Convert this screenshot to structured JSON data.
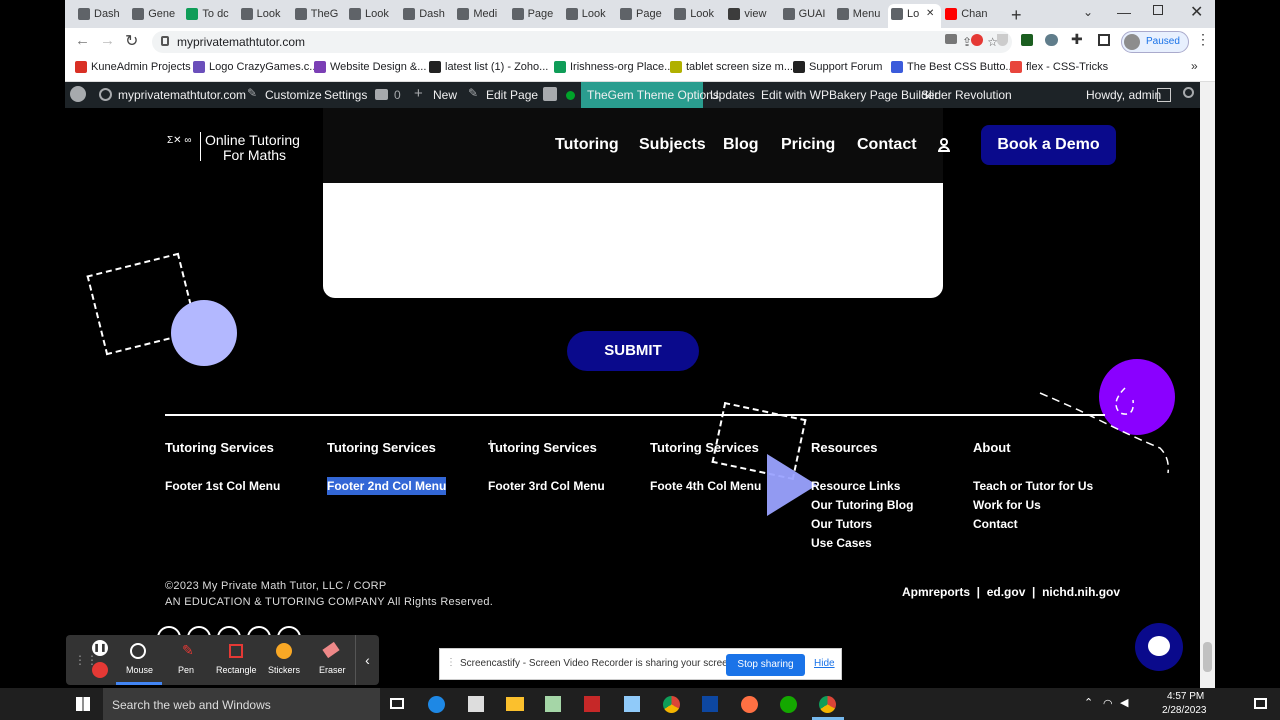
{
  "browser": {
    "tabs": [
      {
        "label": "Dash",
        "color": "#5f6368"
      },
      {
        "label": "Gene",
        "color": "#5f6368"
      },
      {
        "label": "To dc",
        "color": "#0f9d58"
      },
      {
        "label": "Look",
        "color": "#5f6368"
      },
      {
        "label": "TheG",
        "color": "#5f6368"
      },
      {
        "label": "Look",
        "color": "#5f6368"
      },
      {
        "label": "Dash",
        "color": "#5f6368"
      },
      {
        "label": "Medi",
        "color": "#5f6368"
      },
      {
        "label": "Page",
        "color": "#5f6368"
      },
      {
        "label": "Look",
        "color": "#5f6368"
      },
      {
        "label": "Page",
        "color": "#5f6368"
      },
      {
        "label": "Look",
        "color": "#5f6368"
      },
      {
        "label": "view",
        "color": "#3c3c3c"
      },
      {
        "label": "GUAI",
        "color": "#5f6368"
      },
      {
        "label": "Menu",
        "color": "#5f6368"
      },
      {
        "label": "Lo",
        "color": "#5f6368"
      },
      {
        "label": "Chan",
        "color": "#ff0000"
      }
    ],
    "url": "myprivatemathtutor.com",
    "profile_status": "Paused",
    "bookmarks": [
      {
        "label": "KuneAdmin Projects",
        "color": "#d93025"
      },
      {
        "label": "Logo CrazyGames.c...",
        "color": "#6b4fbb"
      },
      {
        "label": "Website Design &...",
        "color": "#7b3fb5"
      },
      {
        "label": "latest list (1) - Zoho...",
        "color": "#222222"
      },
      {
        "label": "Irishness-org Place...",
        "color": "#0f9d58"
      },
      {
        "label": "tablet screen size m...",
        "color": "#b0b000"
      },
      {
        "label": "Support Forum",
        "color": "#222222"
      },
      {
        "label": "The Best CSS Butto...",
        "color": "#3b5bdb"
      },
      {
        "label": "flex - CSS-Tricks",
        "color": "#e8453c"
      }
    ]
  },
  "wpbar": {
    "site": "myprivatemathtutor.com",
    "customize": "Customize",
    "settings": "Settings",
    "comments": "0",
    "new": "New",
    "edit_page": "Edit Page",
    "theme_options": "TheGem Theme Options",
    "updates": "Updates",
    "wpbakery": "Edit with WPBakery Page Builder",
    "slider": "Slider Revolution",
    "howdy": "Howdy, admin"
  },
  "site": {
    "logo_line1": "Online Tutoring",
    "logo_line2": "For Maths",
    "logo_mark": "Σ✕ ∞",
    "nav": [
      "Tutoring",
      "Subjects",
      "Blog",
      "Pricing",
      "Contact"
    ],
    "demo_button": "Book a Demo",
    "submit": "SUBMIT",
    "footer": {
      "col1": {
        "heading": "Tutoring Services",
        "link": "Footer 1st Col Menu"
      },
      "col2": {
        "heading": "Tutoring Services",
        "link": "Footer 2nd Col Menu"
      },
      "col3": {
        "heading": "Tutoring Services",
        "link": "Footer 3rd Col Menu"
      },
      "col4": {
        "heading": "Tutoring Services",
        "link": "Foote 4th Col Menu"
      },
      "col5": {
        "heading": "Resources",
        "links": [
          "Resource Links",
          "Our Tutoring Blog",
          "Our Tutors",
          "Use Cases"
        ]
      },
      "col6": {
        "heading": "About",
        "links": [
          "Teach or Tutor for Us",
          "Work for Us",
          "Contact"
        ]
      }
    },
    "copyright_1": "©2023 My Private Math Tutor, LLC / CORP",
    "copyright_2": "AN EDUCATION & TUTORING COMPANY All Rights Reserved.",
    "refs": "Apmreports  |  ed.gov  |  nichd.nih.gov"
  },
  "screencastify_tools": [
    "Mouse",
    "Pen",
    "Rectangle",
    "Stickers",
    "Eraser"
  ],
  "sharing": {
    "message": "Screencastify - Screen Video Recorder is sharing your screen.",
    "stop": "Stop sharing",
    "hide": "Hide"
  },
  "taskbar": {
    "search": "Search the web and Windows",
    "time": "4:57 PM",
    "date": "2/28/2023"
  },
  "colors": {
    "brand_blue": "#0a0a8c",
    "circle_lavender": "#b3b8ff",
    "circle_purple": "#8a00ff",
    "theme_green": "#00a32a"
  }
}
